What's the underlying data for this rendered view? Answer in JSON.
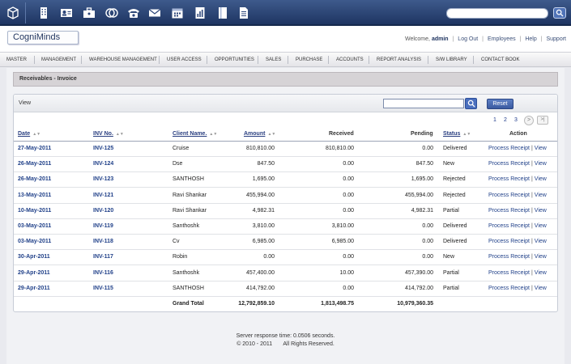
{
  "topbar": {
    "icons": [
      "box-icon",
      "building-icon",
      "contacts-icon",
      "briefcase-icon",
      "coins-icon",
      "phone-icon",
      "mail-icon",
      "calendar-icon",
      "report-icon",
      "book-icon",
      "document-icon"
    ],
    "search_placeholder": ""
  },
  "header": {
    "logo": "CogniMinds",
    "welcome_prefix": "Welcome,",
    "user": "admin",
    "links": [
      "Log Out",
      "Employees",
      "Help",
      "Support"
    ]
  },
  "menu": [
    "MASTER",
    "MANAGEMENT",
    "WAREHOUSE MANAGEMENT",
    "USER ACCESS",
    "OPPORTUNITIES",
    "SALES",
    "PURCHASE",
    "ACCOUNTS",
    "REPORT ANALYSIS",
    "S/W LIBRARY",
    "CONTACT BOOK"
  ],
  "page": {
    "section_title": "Receivables - Invoice",
    "panel_title": "View",
    "search_value": "",
    "reset_label": "Reset",
    "pages": [
      "1",
      "2",
      "3"
    ],
    "next_label": ">",
    "last_label": ">|"
  },
  "table": {
    "headers": {
      "date": "Date",
      "inv": "INV No.",
      "client": "Client Name.",
      "amount": "Amount",
      "received": "Received",
      "pending": "Pending",
      "status": "Status",
      "action": "Action"
    },
    "rows": [
      {
        "date": "27-May-2011",
        "inv": "INV-125",
        "client": "Cruise",
        "amount": "810,810.00",
        "received": "810,810.00",
        "pending": "0.00",
        "status": "Delivered"
      },
      {
        "date": "26-May-2011",
        "inv": "INV-124",
        "client": "Dse",
        "amount": "847.50",
        "received": "0.00",
        "pending": "847.50",
        "status": "New"
      },
      {
        "date": "26-May-2011",
        "inv": "INV-123",
        "client": "SANTHOSH",
        "amount": "1,695.00",
        "received": "0.00",
        "pending": "1,695.00",
        "status": "Rejected"
      },
      {
        "date": "13-May-2011",
        "inv": "INV-121",
        "client": "Ravi Shankar",
        "amount": "455,994.00",
        "received": "0.00",
        "pending": "455,994.00",
        "status": "Rejected"
      },
      {
        "date": "10-May-2011",
        "inv": "INV-120",
        "client": "Ravi Shankar",
        "amount": "4,982.31",
        "received": "0.00",
        "pending": "4,982.31",
        "status": "Partial"
      },
      {
        "date": "03-May-2011",
        "inv": "INV-119",
        "client": "Santhoshk",
        "amount": "3,810.00",
        "received": "3,810.00",
        "pending": "0.00",
        "status": "Delivered"
      },
      {
        "date": "03-May-2011",
        "inv": "INV-118",
        "client": "Cv",
        "amount": "6,985.00",
        "received": "6,985.00",
        "pending": "0.00",
        "status": "Delivered"
      },
      {
        "date": "30-Apr-2011",
        "inv": "INV-117",
        "client": "Robin",
        "amount": "0.00",
        "received": "0.00",
        "pending": "0.00",
        "status": "New"
      },
      {
        "date": "29-Apr-2011",
        "inv": "INV-116",
        "client": "Santhoshk",
        "amount": "457,400.00",
        "received": "10.00",
        "pending": "457,390.00",
        "status": "Partial"
      },
      {
        "date": "29-Apr-2011",
        "inv": "INV-115",
        "client": "SANTHOSH",
        "amount": "414,792.00",
        "received": "0.00",
        "pending": "414,792.00",
        "status": "Partial"
      }
    ],
    "action_process": "Process Receipt",
    "action_separator": "|",
    "action_view": "View",
    "total": {
      "label": "Grand Total",
      "amount": "12,792,859.10",
      "received": "1,813,498.75",
      "pending": "10,979,360.35"
    }
  },
  "footer": {
    "response": "Server response time: 0.0506 seconds.",
    "copyright": "© 2010 - 2011",
    "rights": "All Rights Reserved."
  }
}
